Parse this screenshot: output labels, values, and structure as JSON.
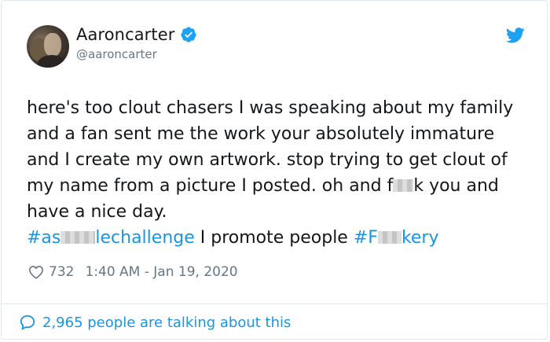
{
  "tweet": {
    "display_name": "Aaroncarter",
    "handle": "@aaroncarter",
    "text_segments": [
      "here's too clout chasers I was speaking about my family and a fan sent me the work your absolutely immature and I create my own artwork. stop trying to get clout of my name from a picture I posted. oh and f",
      "k you and have a nice day. ",
      " I promote people "
    ],
    "hashtag1_start": "#as",
    "hashtag1_end": "lechallenge",
    "hashtag2_start": "#F",
    "hashtag2_end": "kery",
    "like_count": "732",
    "timestamp": "1:40 AM - Jan 19, 2020",
    "talking_text": "2,965 people are talking about this"
  },
  "colors": {
    "link": "#1b95e0",
    "verified": "#1da1f2",
    "secondary_text": "#657786"
  },
  "icons": {
    "verified": "verified-badge-icon",
    "bird": "twitter-bird-icon",
    "heart": "heart-icon",
    "bubble": "speech-bubble-icon"
  }
}
